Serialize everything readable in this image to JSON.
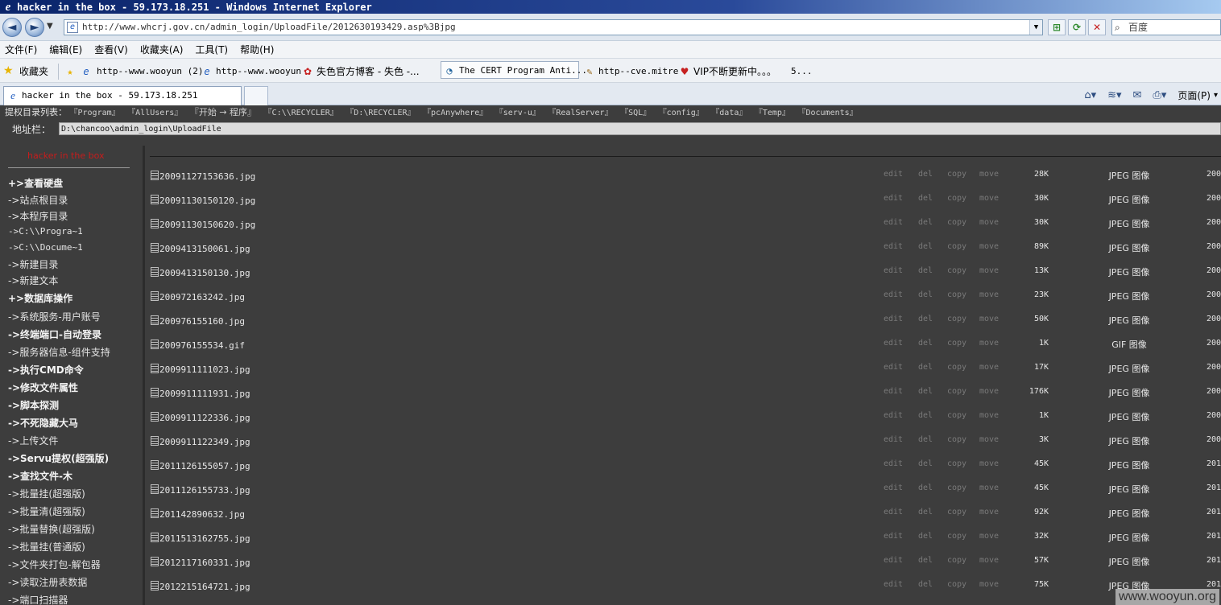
{
  "window": {
    "title": "hacker in the box - 59.173.18.251 - Windows Internet Explorer"
  },
  "toolbar": {
    "back_symbol": "◄",
    "forward_symbol": "►",
    "dropdown_symbol": "▼",
    "url": "http://www.whcrj.gov.cn/admin_login/UploadFile/2012630193429.asp%3Bjpg",
    "compat_symbol": "⊞",
    "refresh_symbol": "⟳",
    "stop_symbol": "✕",
    "search_placeholder": "百度"
  },
  "menu": [
    "文件(F)",
    "编辑(E)",
    "查看(V)",
    "收藏夹(A)",
    "工具(T)",
    "帮助(H)"
  ],
  "favorites": {
    "label": "收藏夹",
    "items": [
      "http--www.wooyun (2)",
      "http--www.wooyun",
      "失色官方博客 - 失色 -...",
      "The CERT Program Anti...",
      "http--cve.mitre",
      "VIP不断更新中。。。",
      "5..."
    ]
  },
  "tab": {
    "title": "hacker in the box - 59.173.18.251"
  },
  "commandbar": {
    "page_label": "页面(P)"
  },
  "page": {
    "path_label": "提权目录列表：",
    "path_items": [
      "『Program』",
      "『AllUsers』",
      "『开始 → 程序』",
      "『C:\\\\RECYCLER』",
      "『D:\\RECYCLER』",
      "『pcAnywhere』",
      "『serv-u』",
      "『RealServer』",
      "『SQL』",
      "『config』",
      "『data』",
      "『Temp』",
      "『Documents』"
    ],
    "address_label": "地址栏：",
    "address_value": "D:\\chancoo\\admin_login\\UploadFile"
  },
  "sidebar": {
    "brand": "hacker in the box",
    "items": [
      "+>查看硬盘",
      "->站点根目录",
      "->本程序目录",
      "->C:\\\\Progra~1",
      "->C:\\\\Docume~1",
      "->新建目录",
      "->新建文本",
      "+>数据库操作",
      "->系统服务-用户账号",
      "->终端端口-自动登录",
      "->服务器信息-组件支持",
      "->执行CMD命令",
      "->修改文件属性",
      "->脚本探测",
      "->不死隐藏大马",
      "->上传文件",
      "->Servu提权(超强版)",
      "->查找文件-木",
      "->批量挂(超强版)",
      "->批量清(超强版)",
      "->批量替换(超强版)",
      "->批量挂(普通版)",
      "->文件夹打包-解包器",
      "->读取注册表数据",
      "->端口扫描器"
    ]
  },
  "actions": {
    "edit": "edit",
    "del": "del",
    "copy": "copy",
    "move": "move"
  },
  "files": [
    {
      "name": "20091127153636.jpg",
      "size": "28K",
      "type": "JPEG 图像",
      "date": "200"
    },
    {
      "name": "20091130150120.jpg",
      "size": "30K",
      "type": "JPEG 图像",
      "date": "200"
    },
    {
      "name": "20091130150620.jpg",
      "size": "30K",
      "type": "JPEG 图像",
      "date": "200"
    },
    {
      "name": "2009413150061.jpg",
      "size": "89K",
      "type": "JPEG 图像",
      "date": "200"
    },
    {
      "name": "2009413150130.jpg",
      "size": "13K",
      "type": "JPEG 图像",
      "date": "200"
    },
    {
      "name": "200972163242.jpg",
      "size": "23K",
      "type": "JPEG 图像",
      "date": "200"
    },
    {
      "name": "200976155160.jpg",
      "size": "50K",
      "type": "JPEG 图像",
      "date": "200"
    },
    {
      "name": "200976155534.gif",
      "size": "1K",
      "type": "GIF 图像",
      "date": "200"
    },
    {
      "name": "2009911111023.jpg",
      "size": "17K",
      "type": "JPEG 图像",
      "date": "200"
    },
    {
      "name": "2009911111931.jpg",
      "size": "176K",
      "type": "JPEG 图像",
      "date": "200"
    },
    {
      "name": "2009911122336.jpg",
      "size": "1K",
      "type": "JPEG 图像",
      "date": "200"
    },
    {
      "name": "2009911122349.jpg",
      "size": "3K",
      "type": "JPEG 图像",
      "date": "200"
    },
    {
      "name": "2011126155057.jpg",
      "size": "45K",
      "type": "JPEG 图像",
      "date": "201"
    },
    {
      "name": "2011126155733.jpg",
      "size": "45K",
      "type": "JPEG 图像",
      "date": "201"
    },
    {
      "name": "201142890632.jpg",
      "size": "92K",
      "type": "JPEG 图像",
      "date": "201"
    },
    {
      "name": "2011513162755.jpg",
      "size": "32K",
      "type": "JPEG 图像",
      "date": "201"
    },
    {
      "name": "2012117160331.jpg",
      "size": "57K",
      "type": "JPEG 图像",
      "date": "201"
    },
    {
      "name": "2012215164721.jpg",
      "size": "75K",
      "type": "JPEG 图像",
      "date": "201"
    }
  ],
  "watermark": "www.wooyun.org"
}
